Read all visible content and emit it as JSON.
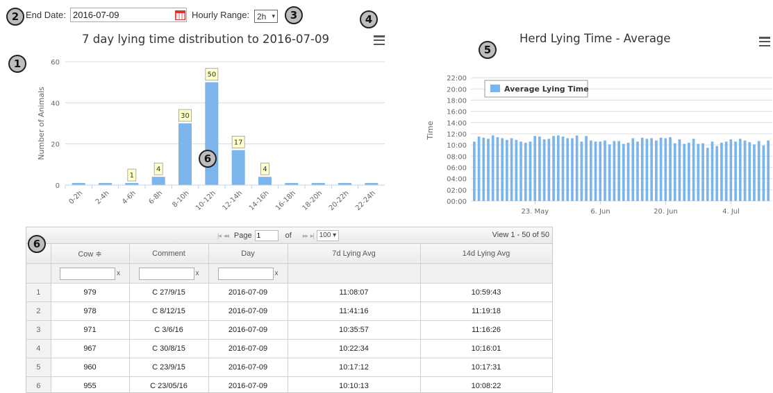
{
  "controls": {
    "end_date_label": "End Date:",
    "end_date_value": "2016-07-09",
    "hourly_range_label": "Hourly Range:",
    "hourly_range_value": "2h",
    "dropdown_arrow": "▾",
    "calendar_icon": "calendar-icon"
  },
  "callouts": [
    "1",
    "2",
    "3",
    "4",
    "5",
    "6",
    "6"
  ],
  "charts": {
    "distribution": {
      "menu_icon": "hamburger-menu-icon"
    },
    "herd": {
      "menu_icon": "hamburger-menu-icon"
    }
  },
  "chart_data": [
    {
      "type": "bar",
      "title": "7 day lying time distribution to 2016-07-09",
      "ylabel": "Number of Animals",
      "xlabel": "",
      "categories": [
        "0-2h",
        "2-4h",
        "4-6h",
        "6-8h",
        "8-10h",
        "10-12h",
        "12-14h",
        "14-16h",
        "16-18h",
        "18-20h",
        "20-22h",
        "22-24h"
      ],
      "values": [
        1,
        1,
        1,
        4,
        30,
        50,
        17,
        4,
        1,
        1,
        1,
        1
      ],
      "data_labels": [
        "",
        "",
        "1",
        "4",
        "30",
        "50",
        "17",
        "4",
        "",
        "",
        "",
        ""
      ],
      "ylim": [
        0,
        60
      ],
      "yticks": [
        0,
        20,
        40,
        60
      ],
      "grid": true,
      "color": "#7cb5ec",
      "label_bg": "#ffffcc"
    },
    {
      "type": "bar",
      "title": "Herd Lying Time - Average",
      "ylabel": "Time",
      "xlabel": "",
      "legend": {
        "entries": [
          "Average Lying Time"
        ],
        "placement": "top-left"
      },
      "yticks": [
        "00:00",
        "02:00",
        "04:00",
        "06:00",
        "08:00",
        "10:00",
        "12:00",
        "14:00",
        "16:00",
        "18:00",
        "20:00",
        "22:00"
      ],
      "ylim_hours": [
        0,
        23
      ],
      "xticks": [
        "23. May",
        "6. Jun",
        "20. Jun",
        "4. Jul"
      ],
      "xtick_index": [
        13,
        27,
        41,
        55
      ],
      "color": "#7cb5ec",
      "values_hours": [
        10.6,
        11.5,
        11.3,
        11.1,
        11.7,
        11.4,
        11.2,
        10.9,
        11.2,
        10.9,
        10.6,
        10.4,
        10.6,
        11.6,
        11.5,
        11.0,
        11.1,
        11.6,
        11.7,
        11.5,
        11.2,
        11.2,
        11.7,
        10.6,
        11.6,
        10.8,
        10.6,
        10.6,
        10.8,
        10.1,
        10.7,
        10.7,
        10.2,
        10.4,
        11.2,
        10.6,
        11.3,
        11.1,
        11.2,
        10.8,
        11.3,
        11.2,
        11.4,
        10.3,
        11.0,
        10.2,
        10.4,
        11.1,
        10.2,
        10.3,
        9.5,
        10.6,
        9.8,
        10.4,
        10.6,
        11.0,
        10.6,
        11.1,
        10.8,
        10.5,
        10.1,
        10.7,
        9.9,
        10.8
      ]
    }
  ],
  "grid": {
    "pager": {
      "page_label": "Page",
      "page_value": "1",
      "of_label": "of",
      "rows_per_page": "100",
      "rows_arrow": "▾",
      "view_text": "View 1 - 50 of 50",
      "first_icon": "|◂",
      "prev_icon": "◂◂",
      "next_icon": "▸▸",
      "last_icon": "▸|"
    },
    "columns": [
      "Cow ≑",
      "Comment",
      "Day",
      "7d Lying Avg",
      "14d Lying Avg"
    ],
    "clear_x": "x",
    "rows": [
      [
        "1",
        "979",
        "C 27/9/15",
        "2016-07-09",
        "11:08:07",
        "10:59:43"
      ],
      [
        "2",
        "978",
        "C 8/12/15",
        "2016-07-09",
        "11:41:16",
        "11:19:18"
      ],
      [
        "3",
        "971",
        "C 3/6/16",
        "2016-07-09",
        "10:35:57",
        "11:16:26"
      ],
      [
        "4",
        "967",
        "C 30/8/15",
        "2016-07-09",
        "10:22:34",
        "10:16:01"
      ],
      [
        "5",
        "960",
        "C 23/9/15",
        "2016-07-09",
        "10:17:12",
        "10:17:31"
      ],
      [
        "6",
        "955",
        "C 23/05/16",
        "2016-07-09",
        "10:10:13",
        "10:08:22"
      ]
    ]
  }
}
